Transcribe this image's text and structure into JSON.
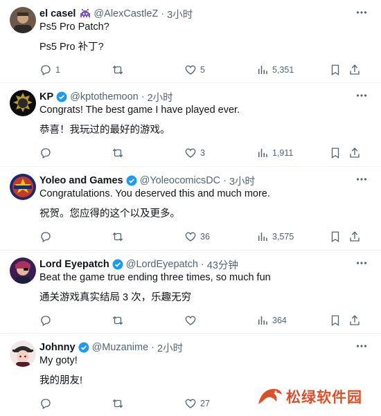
{
  "tweets": [
    {
      "name": "el casel",
      "handle": "@AlexCastleZ",
      "time": "3小时",
      "lines": [
        "Ps5 Pro Patch?",
        "Ps5 Pro 补丁?"
      ],
      "replies": "1",
      "retweets": "",
      "likes": "5",
      "views": "5,351",
      "verified": false
    },
    {
      "name": "KP",
      "handle": "@kptothemoon",
      "time": "2小时",
      "lines": [
        "Congrats! The best game I have played ever.",
        "恭喜！我玩过的最好的游戏。"
      ],
      "replies": "",
      "retweets": "",
      "likes": "3",
      "views": "1,911",
      "verified": true
    },
    {
      "name": "Yoleo and Games",
      "handle": "@YoleocomicsDC",
      "time": "3小时",
      "lines": [
        "Congratulations. You deserved this and much more.",
        "祝贺。您应得的这个以及更多。"
      ],
      "replies": "",
      "retweets": "",
      "likes": "36",
      "views": "3,575",
      "verified": true
    },
    {
      "name": "Lord Eyepatch",
      "handle": "@LordEyepatch",
      "time": "43分钟",
      "lines": [
        "Beat the game true ending three times, so much fun",
        "通关游戏真实结局 3 次，乐趣无穷"
      ],
      "replies": "",
      "retweets": "",
      "likes": "",
      "views": "364",
      "verified": true
    },
    {
      "name": "Johnny",
      "handle": "@Muzanime",
      "time": "2小时",
      "lines": [
        "My goty!",
        "我的朋友!"
      ],
      "replies": "",
      "retweets": "",
      "likes": "27",
      "views": "",
      "verified": true
    }
  ],
  "separator_dot": "·",
  "watermark": "松绿软件园",
  "colors": {
    "verified": "#1d9bf0",
    "muted": "#536471",
    "text": "#0f1419",
    "watermark": "#d8512a"
  }
}
